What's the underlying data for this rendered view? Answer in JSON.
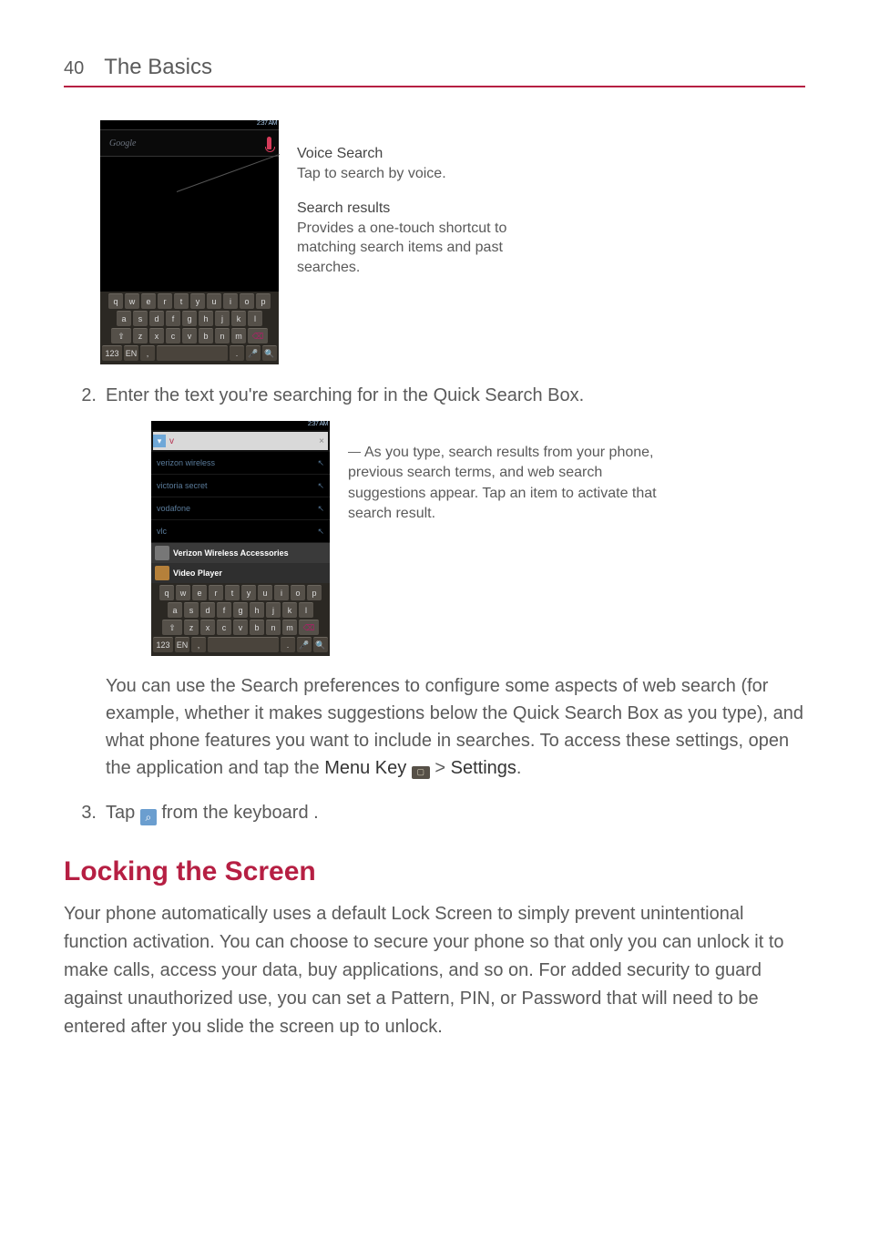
{
  "header": {
    "page_number": "40",
    "title": "The Basics"
  },
  "phone1": {
    "status_time": "2:37 AM",
    "google_placeholder": "Google",
    "rows": {
      "r1": [
        "q",
        "w",
        "e",
        "r",
        "t",
        "y",
        "u",
        "i",
        "o",
        "p"
      ],
      "r2": [
        "a",
        "s",
        "d",
        "f",
        "g",
        "h",
        "j",
        "k",
        "l"
      ],
      "r3": [
        "⇧",
        "z",
        "x",
        "c",
        "v",
        "b",
        "n",
        "m",
        "⌫"
      ],
      "r4": [
        "123",
        "EN",
        ",",
        "space",
        ".",
        "🎤",
        "🔍"
      ]
    }
  },
  "callouts1": {
    "voice_title": "Voice Search",
    "voice_body": "Tap to search by voice.",
    "results_title": "Search results",
    "results_body": "Provides a one-touch shortcut to matching search items and past searches."
  },
  "step2": {
    "num": "2.",
    "text": "Enter the text you're searching for in the Quick Search Box."
  },
  "phone2": {
    "status_time": "2:37 AM",
    "input_char": "v",
    "list": [
      {
        "label": "verizon wireless",
        "hint": "↖"
      },
      {
        "label": "victoria secret",
        "hint": "↖"
      },
      {
        "label": "vodafone",
        "hint": "↖"
      },
      {
        "label": "vlc",
        "hint": "↖"
      }
    ],
    "suggest_a": "Verizon Wireless Accessories",
    "suggest_b": "Video Player",
    "rows": {
      "r1": [
        "q",
        "w",
        "e",
        "r",
        "t",
        "y",
        "u",
        "i",
        "o",
        "p"
      ],
      "r2": [
        "a",
        "s",
        "d",
        "f",
        "g",
        "h",
        "j",
        "k",
        "l"
      ],
      "r3": [
        "⇧",
        "z",
        "x",
        "c",
        "v",
        "b",
        "n",
        "m",
        "⌫"
      ],
      "r4": [
        "123",
        "EN",
        ",",
        "space",
        ".",
        "🎤",
        "🔍"
      ]
    }
  },
  "callouts2": {
    "text": "As you type, search results from your phone, previous search terms, and web search suggestions appear. Tap an item to activate that search result."
  },
  "para_after": {
    "a": "You can use the Search preferences to configure some aspects of web search (for example, whether it makes suggestions below the Quick Search Box as you type), and what phone features you want to include in searches. To access these settings, open the application and tap the ",
    "menu_key": "Menu Key",
    "gt": " > ",
    "settings": "Settings",
    "period": "."
  },
  "step3": {
    "num": "3.",
    "before": "Tap ",
    "after": " from the keyboard ."
  },
  "section_heading": "Locking the Screen",
  "locking_para": "Your phone automatically uses a default Lock Screen to simply prevent unintentional function activation. You can choose to secure your phone so that only you can unlock it to make calls, access your data, buy applications, and so on. For added security to guard against unauthorized use, you can set a Pattern, PIN, or Password that will need to be entered after you slide the screen up to unlock."
}
